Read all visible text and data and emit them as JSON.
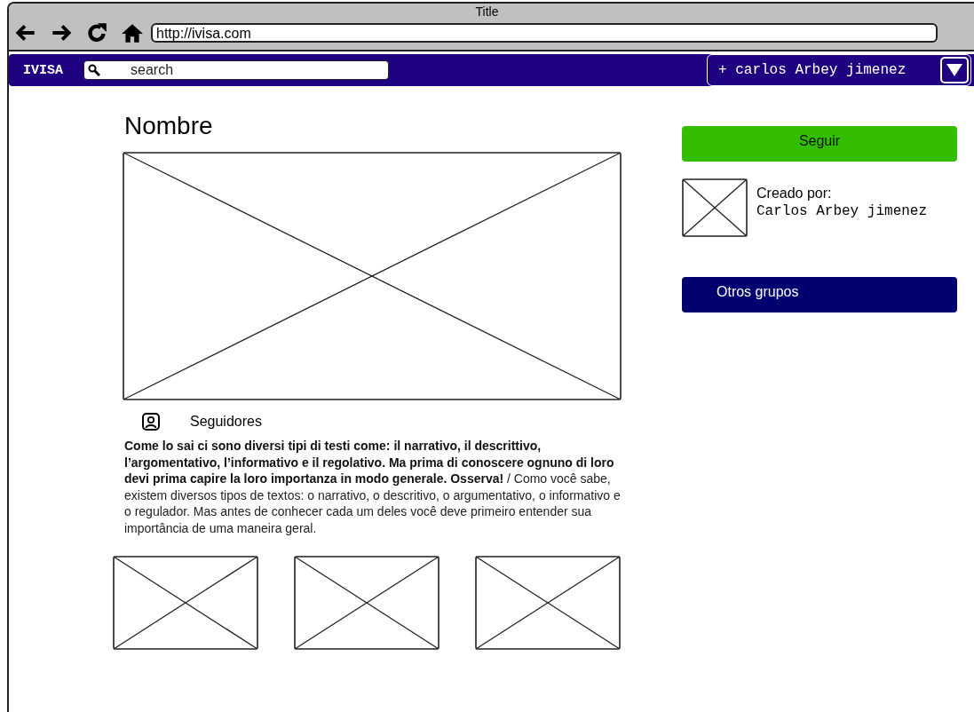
{
  "window": {
    "title": "Title"
  },
  "browser": {
    "url": "http://ivisa.com"
  },
  "navbar": {
    "brand": "IVISA",
    "search": {
      "placeholder": "search"
    },
    "user": "+ carlos Arbey jimenez"
  },
  "group": {
    "name": "Nombre",
    "cover": {
      "kind": "placeholder"
    },
    "followers_label": "Seguidores",
    "description": "**Come lo sai ci sono diversi tipi di testi come: il narrativo, il descrittivo, l’argomentativo, l’informativo e il regolativo. Ma prima di conoscere ognuno di loro devi prima capire la loro importanza in modo generale. Osserva!** / Como você sabe, existem diversos tipos de textos: o narrativo, o descritivo, o argumentativo, o informativo e o regulador. Mas antes de conhecer cada um deles você deve primeiro entender sua importância de uma maneira geral.",
    "thumbnails": [
      {
        "kind": "placeholder"
      },
      {
        "kind": "placeholder"
      },
      {
        "kind": "placeholder"
      }
    ]
  },
  "sidebar": {
    "follow_button": "Seguir",
    "creator": {
      "avatar": {
        "kind": "placeholder"
      },
      "label": "Creado por:",
      "name": "Carlos Arbey jimenez"
    },
    "other_groups_button": "Otros grupos"
  }
}
